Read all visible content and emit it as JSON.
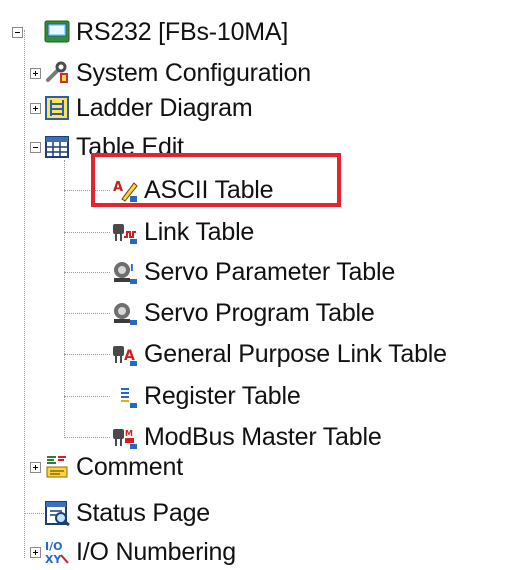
{
  "tree": {
    "root": {
      "label": "RS232 [FBs-10MA]",
      "icon": "plc-device-icon",
      "expanded": true
    },
    "children": [
      {
        "label": "System Configuration",
        "icon": "system-configuration-icon",
        "expanded": false
      },
      {
        "label": "Ladder Diagram",
        "icon": "ladder-diagram-icon",
        "expanded": false
      },
      {
        "label": "Table Edit",
        "icon": "table-edit-icon",
        "expanded": true,
        "children": [
          {
            "label": "ASCII Table",
            "icon": "ascii-table-icon",
            "highlighted": true
          },
          {
            "label": "Link Table",
            "icon": "link-table-icon"
          },
          {
            "label": "Servo Parameter Table",
            "icon": "servo-parameter-table-icon"
          },
          {
            "label": "Servo Program Table",
            "icon": "servo-program-table-icon"
          },
          {
            "label": "General Purpose Link Table",
            "icon": "general-purpose-link-table-icon"
          },
          {
            "label": "Register Table",
            "icon": "register-table-icon"
          },
          {
            "label": "ModBus Master Table",
            "icon": "modbus-master-table-icon"
          }
        ]
      },
      {
        "label": "Comment",
        "icon": "comment-icon",
        "expanded": false
      },
      {
        "label": "Status Page",
        "icon": "status-page-icon"
      },
      {
        "label": "I/O Numbering",
        "icon": "io-numbering-icon",
        "expanded": false
      }
    ]
  },
  "colors": {
    "highlight_border": "#e3242b",
    "tree_line": "#9a9a9a"
  }
}
